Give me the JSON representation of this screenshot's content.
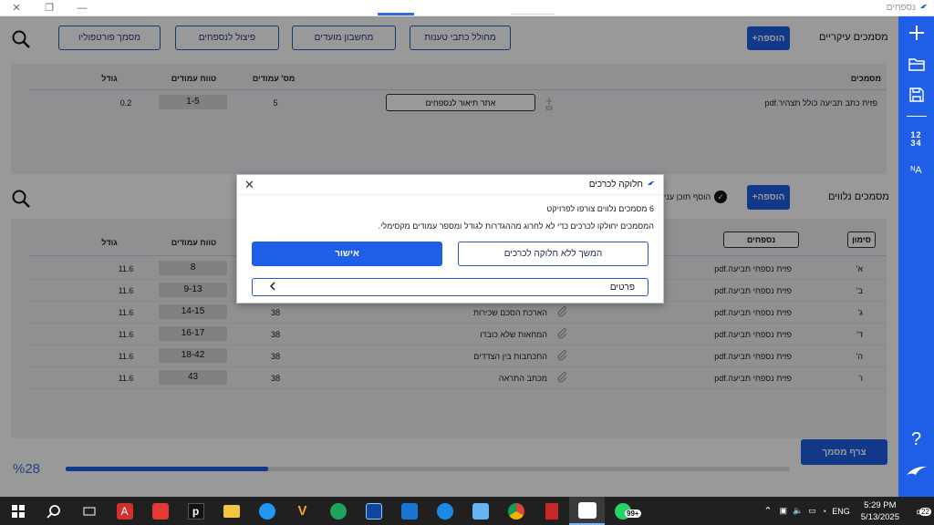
{
  "titlebar": {
    "title": "נספחים",
    "close": "✕",
    "restore": "❐",
    "minimize": "—"
  },
  "toolbar": {
    "search_icon": "search-icon",
    "buttons": [
      "מסמך פורטפוליו",
      "פיצול לנספחים",
      "מחשבון מועדים",
      "מחולל כתבי טענות"
    ],
    "add_label": "הוספה+",
    "main_docs_title": "מסמכים עיקריים"
  },
  "main_table": {
    "headers": {
      "docs": "מסמכים",
      "pages": "מס' עמודים",
      "range": "טווח עמודים",
      "size": "גודל"
    },
    "row": {
      "name": "פזית כתב תביעה כולל תצהיר.pdf",
      "button": "אתר תיאור לנספחים",
      "pages": "5",
      "range": "1-5",
      "size": "0.2"
    }
  },
  "attachments": {
    "title": "מסמכים נלווים",
    "add_label": "הוספה+",
    "toggle_label": "הוסף תוכן עני",
    "headers": {
      "mark": "סימון",
      "annex": "נספחים",
      "range": "טווח עמודים",
      "size": "גודל"
    },
    "rows": [
      {
        "mark": "א'",
        "file": "פזית נספחי תביעה.pdf",
        "desc": "",
        "pages": "",
        "range": "8",
        "size": "11.6"
      },
      {
        "mark": "ב'",
        "file": "פזית נספחי תביעה.pdf",
        "desc": "",
        "pages": "",
        "range": "9-13",
        "size": "11.6"
      },
      {
        "mark": "ג'",
        "file": "פזית נספחי תביעה.pdf",
        "desc": "הארכת הסכם שכירות",
        "pages": "38",
        "range": "14-15",
        "size": "11.6"
      },
      {
        "mark": "ד'",
        "file": "פזית נספחי תביעה.pdf",
        "desc": "המחאות שלא כובדו",
        "pages": "38",
        "range": "16-17",
        "size": "11.6"
      },
      {
        "mark": "ה'",
        "file": "פזית נספחי תביעה.pdf",
        "desc": "התכתבות בין הצדדים",
        "pages": "38",
        "range": "18-42",
        "size": "11.6"
      },
      {
        "mark": "ו'",
        "file": "פזית נספחי תביעה.pdf",
        "desc": "מכתב התראה",
        "pages": "38",
        "range": "43",
        "size": "11.6"
      }
    ]
  },
  "footer": {
    "progress_label": "%28",
    "progress": 0.28,
    "attach_button": "צרף מסמך"
  },
  "modal": {
    "title": "חלוקה לכרכים",
    "line1": "6 מסמכים נלווים צורפו לפרויקט",
    "line2": "המסמכים יחולקו לכרכים כדי לא לחרוג מההגדרות לגודל ומספר עמודים מקסימלי.",
    "confirm": "אישור",
    "continue": "המשך ללא חלוקה לכרכים",
    "details": "פרטים",
    "close_icon": "close-icon"
  },
  "rightbar": {
    "numbers_top": "12",
    "numbers_bottom": "34",
    "help": "?",
    "font_label": "A"
  },
  "taskbar": {
    "time": "5:29 PM",
    "date": "5/13/2025",
    "lang": "ENG",
    "notif": "22",
    "whatsapp_badge": "99+"
  },
  "colors": {
    "accent": "#1f5ee6",
    "taskbar": "#202020"
  }
}
